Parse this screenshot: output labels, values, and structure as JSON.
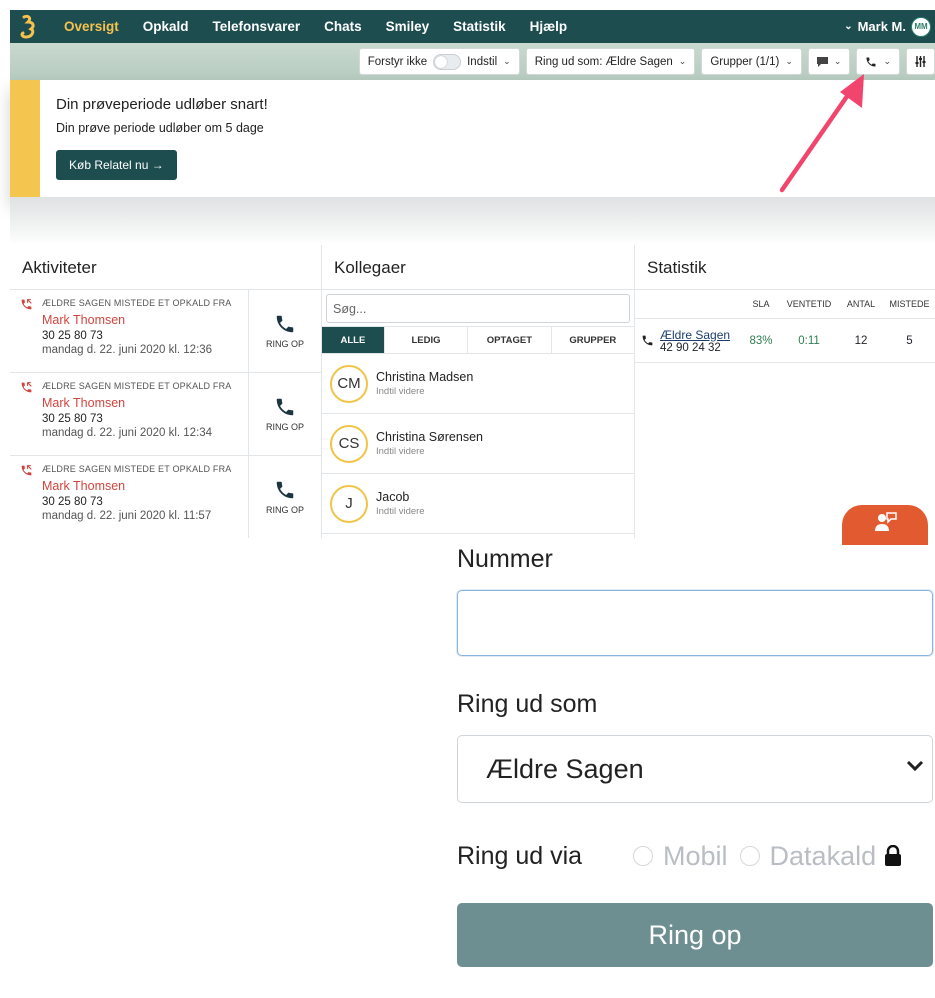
{
  "nav": {
    "items": [
      "Oversigt",
      "Opkald",
      "Telefonsvarer",
      "Chats",
      "Smiley",
      "Statistik",
      "Hjælp"
    ],
    "user_name": "Mark M.",
    "user_initials": "MM"
  },
  "toolbar": {
    "dnd_label": "Forstyr ikke",
    "settings_label": "Indstil",
    "ring_as_label": "Ring ud som: Ældre Sagen",
    "groups_label": "Grupper (1/1)"
  },
  "banner": {
    "title": "Din prøveperiode udløber snart!",
    "text": "Din prøve periode udløber om 5 dage",
    "button": "Køb Relatel nu →"
  },
  "activities": {
    "title": "Aktiviteter",
    "call_label": "RING OP",
    "rows": [
      {
        "label": "ÆLDRE SAGEN MISTEDE ET OPKALD FRA",
        "name": "Mark Thomsen",
        "number": "30 25 80 73",
        "date": "mandag d. 22. juni 2020 kl. 12:36"
      },
      {
        "label": "ÆLDRE SAGEN MISTEDE ET OPKALD FRA",
        "name": "Mark Thomsen",
        "number": "30 25 80 73",
        "date": "mandag d. 22. juni 2020 kl. 12:34"
      },
      {
        "label": "ÆLDRE SAGEN MISTEDE ET OPKALD FRA",
        "name": "Mark Thomsen",
        "number": "30 25 80 73",
        "date": "mandag d. 22. juni 2020 kl. 11:57"
      }
    ]
  },
  "colleagues": {
    "title": "Kollegaer",
    "search_placeholder": "Søg...",
    "tabs": [
      "ALLE",
      "LEDIG",
      "OPTAGET",
      "GRUPPER"
    ],
    "people": [
      {
        "initials": "CM",
        "name": "Christina Madsen",
        "status": "Indtil videre"
      },
      {
        "initials": "CS",
        "name": "Christina Sørensen",
        "status": "Indtil videre"
      },
      {
        "initials": "J",
        "name": "Jacob",
        "status": "Indtil videre"
      }
    ]
  },
  "statistics": {
    "title": "Statistik",
    "headers": [
      "SLA",
      "VENTETID",
      "ANTAL",
      "MISTEDE"
    ],
    "rows": [
      {
        "name": "Ældre Sagen",
        "number": "42 90 24 32",
        "sla": "83%",
        "wait": "0:11",
        "count": "12",
        "missed": "5"
      }
    ]
  },
  "dial_form": {
    "number_label": "Nummer",
    "ring_as_label": "Ring ud som",
    "ring_as_value": "Ældre Sagen",
    "via_label": "Ring ud via",
    "via_options": [
      "Mobil",
      "Datakald"
    ],
    "submit_label": "Ring op"
  },
  "colors": {
    "brand": "#1d4d4f",
    "accent": "#f4c54f",
    "missed": "#d0453e",
    "arrow": "#f2456e",
    "chat": "#e25a2f"
  }
}
